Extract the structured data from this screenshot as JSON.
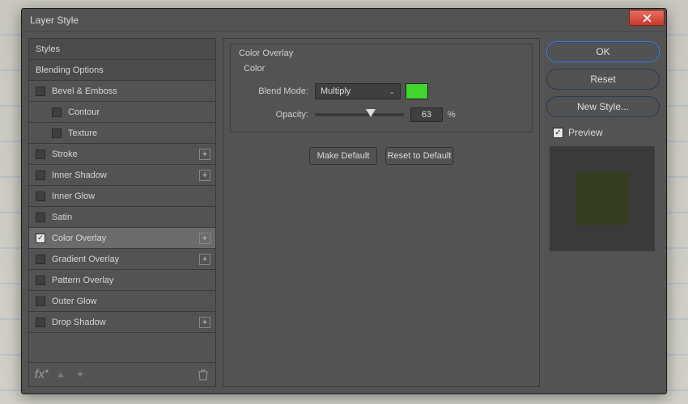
{
  "window": {
    "title": "Layer Style"
  },
  "sidebar": {
    "header": "Styles",
    "blending": "Blending Options",
    "items": [
      {
        "label": "Bevel & Emboss",
        "checked": false,
        "plus": false,
        "indent": false
      },
      {
        "label": "Contour",
        "checked": false,
        "plus": false,
        "indent": true
      },
      {
        "label": "Texture",
        "checked": false,
        "plus": false,
        "indent": true
      },
      {
        "label": "Stroke",
        "checked": false,
        "plus": true,
        "indent": false
      },
      {
        "label": "Inner Shadow",
        "checked": false,
        "plus": true,
        "indent": false
      },
      {
        "label": "Inner Glow",
        "checked": false,
        "plus": false,
        "indent": false
      },
      {
        "label": "Satin",
        "checked": false,
        "plus": false,
        "indent": false
      },
      {
        "label": "Color Overlay",
        "checked": true,
        "plus": true,
        "indent": false,
        "selected": true
      },
      {
        "label": "Gradient Overlay",
        "checked": false,
        "plus": true,
        "indent": false
      },
      {
        "label": "Pattern Overlay",
        "checked": false,
        "plus": false,
        "indent": false
      },
      {
        "label": "Outer Glow",
        "checked": false,
        "plus": false,
        "indent": false
      },
      {
        "label": "Drop Shadow",
        "checked": false,
        "plus": true,
        "indent": false
      }
    ],
    "footer_icons": {
      "fx": "fx",
      "up": "▲",
      "down": "▼",
      "trash": "trash"
    }
  },
  "settings": {
    "group_title": "Color Overlay",
    "sub_title": "Color",
    "blend_mode_label": "Blend Mode:",
    "blend_mode_value": "Multiply",
    "opacity_label": "Opacity:",
    "opacity_value": "63",
    "opacity_unit": "%",
    "opacity_percent": 63,
    "color_hex": "#3fd62f",
    "make_default": "Make Default",
    "reset_default": "Reset to Default"
  },
  "right": {
    "ok": "OK",
    "reset": "Reset",
    "new_style": "New Style...",
    "preview_label": "Preview",
    "preview_checked": true
  }
}
